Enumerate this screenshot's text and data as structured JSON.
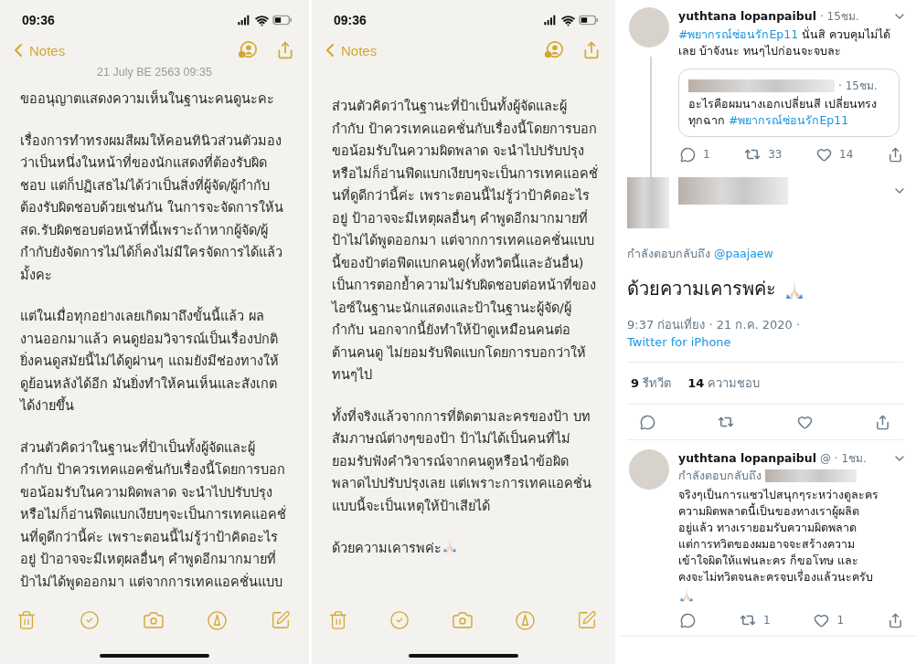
{
  "notes_panels": [
    {
      "status_time": "09:36",
      "back_label": "Notes",
      "date": "21 July BE 2563 09:35",
      "paragraphs": [
        [
          "ขออนุญาตแสดงความเห็นในฐานะคนดูนะคะ"
        ],
        [
          "เรื่องการทำทรงผมสีผมให้คอนทินิวส่วนตัวมอง",
          "ว่าเป็นหนึ่งในหน้าที่ของนักแสดงที่ต้องรับผิด",
          "ชอบ แต่ก็ปฏิเสธไม่ได้ว่าเป็นสิ่งที่ผู้จัด/ผู้กำกับ",
          "ต้องรับผิดชอบด้วยเช่นกัน ในการจะจัดการให้น",
          "สด.รับผิดชอบต่อหน้าที่นี้เพราะถ้าหากผู้จัด/ผู้",
          "กำกับยังจัดการไม่ได้ก็คงไม่มีใครจัดการได้แล้ว",
          "มั้งคะ"
        ],
        [
          "แต่ในเมื่อทุกอย่างเลยเกิดมาถึงขั้นนี้แล้ว ผล",
          "งานออกมาแล้ว คนดูย่อมวิจารณ์เป็นเรื่องปกติ",
          "ยิ่งคนดูสมัยนี้ไม่ได้ดูผ่านๆ แถมยังมีช่องทางให้",
          "ดูย้อนหลังได้อีก มันยิ่งทำให้คนเห็นและสังเกต",
          "ได้ง่ายขึ้น"
        ],
        [
          "ส่วนตัวคิดว่าในฐานะที่ป้าเป็นทั้งผู้จัดและผู้",
          "กำกับ ป้าควรเทคแอคชั่นกับเรื่องนี้โดยการบอก",
          "ขอน้อมรับในความผิดพลาด จะนำไปปรับปรุง",
          "หรือไม่ก็อ่านฟีดแบกเงียบๆจะเป็นการเทคแอคชั่",
          "นที่ดูดีกว่านี้ค่ะ เพราะตอนนี้ไม่รู้ว่าป้าคิดอะไร",
          "อยู่ ป้าอาจจะมีเหตุผลอื่นๆ คำพูดอีกมากมายที่",
          "ป้าไม่ได้พูดออกมา แต่จากการเทคแอคชั่นแบบ"
        ]
      ]
    },
    {
      "status_time": "09:36",
      "back_label": "Notes",
      "paragraphs": [
        [
          "ส่วนตัวคิดว่าในฐานะที่ป้าเป็นทั้งผู้จัดและผู้",
          "กำกับ ป้าควรเทคแอคชั่นกับเรื่องนี้โดยการบอก",
          "ขอน้อมรับในความผิดพลาด จะนำไปปรับปรุง",
          "หรือไม่ก็อ่านฟีดแบกเงียบๆจะเป็นการเทคแอคชั่",
          "นที่ดูดีกว่านี้ค่ะ เพราะตอนนี้ไม่รู้ว่าป้าคิดอะไร",
          "อยู่ ป้าอาจจะมีเหตุผลอื่นๆ คำพูดอีกมากมายที่",
          "ป้าไม่ได้พูดออกมา แต่จากการเทคแอคชั่นแบบ",
          "นี้ของป้าต่อฟีดแบกคนดู(ทั้งทวิตนี้และอันอื่น)",
          "เป็นการตอกย้ำความไม่รับผิดชอบต่อหน้าที่ของ",
          "ไอซ์ในฐานะนักแสดงและป้าในฐานะผู้จัด/ผู้",
          "กำกับ  นอกจากนี้ยังทำให้ป้าดูเหมือนคนต่อ",
          "ต้านคนดู ไม่ยอมรับฟีดแบกโดยการบอกว่าให้",
          "ทนๆไป"
        ],
        [
          "ทั้งที่จริงแล้วจากการที่ติดตามละครของป้า บท",
          "สัมภาษณ์ต่างๆของป้า ป้าไม่ได้เป็นคนที่ไม่",
          "ยอมรับฟังคำวิจารณ์จากคนดูหรือนำข้อผิด",
          "พลาดไปปรับปรุงเลย แต่เพราะการเทคแอคชั่น",
          "แบบนี้จะเป็นเหตุให้ป้าเสียได้"
        ],
        [
          "ด้วยความเคารพค่ะ"
        ]
      ]
    }
  ],
  "twitter": {
    "thread_tweet": {
      "author": "yuthtana lopanpaibul",
      "time": "· 15ชม.",
      "hashtag": "#พยากรณ์ซ่อนรักEp11",
      "text": " นั่นสิ ควบคุมไม่ได้เลย บ้าจังนะ  ทนๆไปก่อนจะจบละ",
      "quote": {
        "time": "· 15ชม.",
        "text": "อะไรคือผมนางเอกเปลี่ยนสี เปลี่ยนทรงทุกฉาก ",
        "hashtag": "#พยากรณ์ซ่อนรักEp11"
      },
      "replies": "1",
      "retweets": "33",
      "likes": "14"
    },
    "main_tweet": {
      "reply_label": "กำลังตอบกลับถึง ",
      "reply_handle": "@paajaew",
      "text": "ด้วยความเคารพค่ะ",
      "timestamp": "9:37 ก่อนเที่ยง · 21 ก.ค. 2020 · ",
      "source": "Twitter for iPhone",
      "retweet_count": "9",
      "retweet_label": "รีทวีต",
      "like_count": "14",
      "like_label": "ความชอบ"
    },
    "reply_tweet": {
      "author": "yuthtana lopanpaibul",
      "meta": "@ · 1ชม.",
      "reply_label": "กำลังตอบกลับถึง",
      "lines": [
        "จริงๆเป็นการแซวไปสนุกๆระหว่างดูละคร",
        "ความผิดพลาดนี้เป็นของทางเราผู้ผลิต",
        "อยู่แล้ว ทางเรายอมรับความผิดพลาด",
        "แต่การทวิตของผมอาจจะสร้างความ",
        "เข้าใจผิดให้แฟนละคร  ก็ขอโทษ และ",
        "คงจะไม่ทวิตจนละครจบเรื่องแล้วนะครับ"
      ],
      "retweets": "1",
      "likes": "1"
    }
  }
}
